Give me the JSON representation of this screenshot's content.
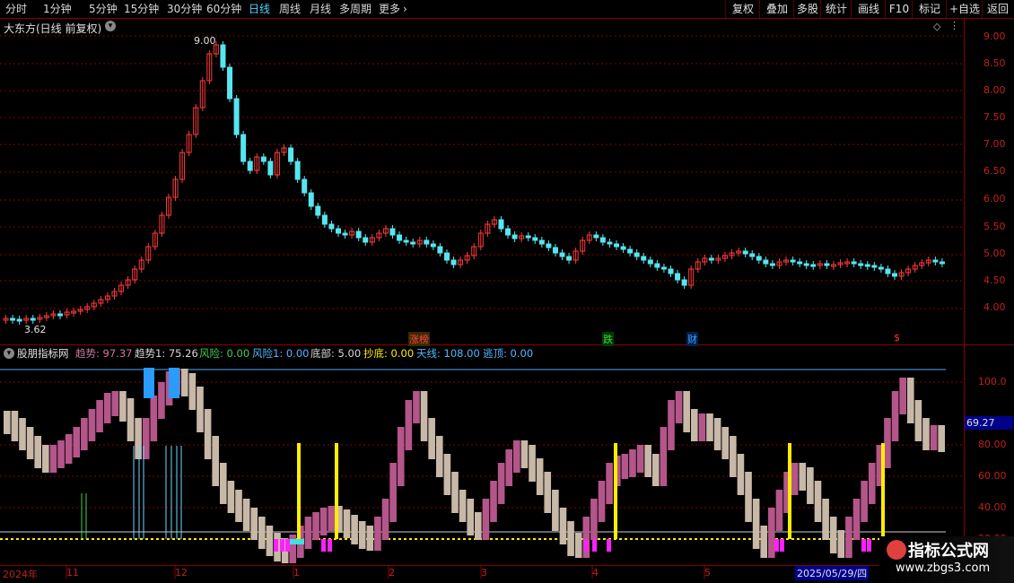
{
  "toolbar": {
    "periods": [
      "分时",
      "1分钟",
      "5分钟",
      "15分钟",
      "30分钟",
      "60分钟",
      "日线",
      "周线",
      "月线",
      "多周期",
      "更多"
    ],
    "more_arrow": "›",
    "buttons": [
      "复权",
      "叠加",
      "多股",
      "统计",
      "画线",
      "F10",
      "标记",
      "+自选",
      "返回"
    ]
  },
  "main_pane": {
    "title": "大东方(日线 前复权)",
    "high_label": "9.00",
    "low_label": "3.62",
    "y_ticks": [
      "9.00",
      "8.50",
      "8.00",
      "7.50",
      "7.00",
      "6.50",
      "6.00",
      "5.50",
      "5.00",
      "4.50",
      "4.00"
    ],
    "markers": [
      {
        "text": "涨榜",
        "color": "#ff4040"
      },
      {
        "text": "跌",
        "color": "#40d040"
      },
      {
        "text": "财",
        "color": "#40a0ff"
      },
      {
        "text": "$",
        "color": "#ff3030"
      }
    ]
  },
  "indicator_pane": {
    "title": "股朋指标网",
    "fields": [
      {
        "label": "趋势: 97.37",
        "color": "#c97aa0"
      },
      {
        "label": "趋势1: 75.26",
        "color": "#d8d8d8"
      },
      {
        "label": "风险: 0.00",
        "color": "#3fd04f"
      },
      {
        "label": "风险1: 0.00",
        "color": "#4fb8ff"
      },
      {
        "label": "底部: 5.00",
        "color": "#d8d8d8"
      },
      {
        "label": "抄底: 0.00",
        "color": "#ffee00"
      },
      {
        "label": "天线: 108.00",
        "color": "#4fb8ff"
      },
      {
        "label": "逃顶: 0.00",
        "color": "#4fb8ff"
      }
    ],
    "y_ticks": [
      "100.0",
      "80.00",
      "60.00",
      "40.00",
      "20.00"
    ],
    "current_value": "69.27"
  },
  "time_axis": {
    "labels": [
      "2024年",
      "11",
      "12",
      "1",
      "2",
      "3",
      "4",
      "5"
    ],
    "cursor_date": "2025/05/29/四"
  },
  "watermark": {
    "title": "指标公式网",
    "url": "www.zbgs3.com"
  },
  "colors": {
    "up": "#ff3b3b",
    "down": "#55e6f0",
    "trend_up": "#b4568a",
    "trend_down": "#c8b8a8",
    "grid": "#8b0000"
  }
}
